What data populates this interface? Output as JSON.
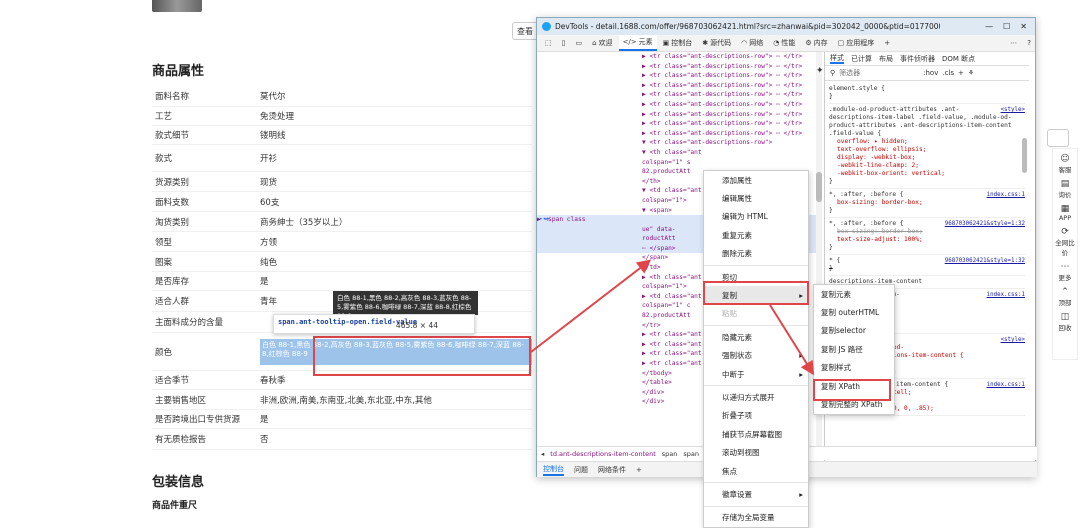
{
  "page": {
    "view_btn": "查看",
    "section_attrs": "商品属性",
    "section_pkg": "包装信息",
    "pkg_sub": "商品件重尺",
    "attrs": [
      {
        "k": "面料名称",
        "v": "莫代尔"
      },
      {
        "k": "工艺",
        "v": "免烫处理"
      },
      {
        "k": "款式细节",
        "v": "镂明线"
      },
      {
        "k": "款式",
        "v": "开衫"
      },
      {
        "k": "货源类别",
        "v": "现货"
      },
      {
        "k": "面料支数",
        "v": "60支"
      },
      {
        "k": "淘货类别",
        "v": "商务绅士（35岁以上）"
      },
      {
        "k": "领型",
        "v": "方领"
      },
      {
        "k": "图案",
        "v": "纯色"
      },
      {
        "k": "是否库存",
        "v": "是"
      },
      {
        "k": "适合人群",
        "v": "青年"
      },
      {
        "k": "主面料成分的含量",
        "v": ""
      },
      {
        "k": "颜色",
        "v": "白色 88-1,黑色 88-2,高灰色 88-3,蓝灰色 88-5,雾紫色 88-6,咖啡绿 88-7,深蓝 88-8,红棕色 88-9"
      },
      {
        "k": "适合季节",
        "v": "春秋季"
      },
      {
        "k": "主要销售地区",
        "v": "非洲,欧洲,南美,东南亚,北美,东北亚,中东,其他"
      },
      {
        "k": "是否跨境出口专供货源",
        "v": "是"
      },
      {
        "k": "有无质检报告",
        "v": "否"
      }
    ],
    "tooltip_text": "白色 88-1,黑色 88-2,高灰色 88-3,蓝灰色 88-5,雾紫色 88-6,咖啡绿 88-7,深蓝 88-8,红棕色 88-9",
    "hint_selector": "span.ant-tooltip-open.field-value",
    "hint_dims": "465.8 × 44"
  },
  "rightbar": [
    "客服",
    "询价",
    "APP",
    "全网比价",
    "更多",
    "顶部",
    "回收"
  ],
  "devtools": {
    "title": "DevTools - detail.1688.com/offer/968703062421.html?src=zhanwai&pid=302042_0000&ptid=01770000000798a6c...",
    "tabs": [
      "欢迎",
      "元素",
      "控制台",
      "源代码",
      "网络",
      "性能",
      "内存",
      "应用程序"
    ],
    "styles_tabs": [
      "样式",
      "已计算",
      "布局",
      "事件侦听器",
      "DOM 断点"
    ],
    "filter_placeholder": "筛选器",
    "filter_hov": ":hov",
    "filter_cls": ".cls",
    "breadcrumb": [
      "td.ant-descriptions-item-content",
      "span",
      "span"
    ],
    "bottom_tabs": [
      "控制台",
      "问题",
      "网络条件"
    ]
  },
  "dom_lines": [
    "▶ <tr class=\"ant-descriptions-row\"> ⋯ </tr>",
    "▶ <tr class=\"ant-descriptions-row\"> ⋯ </tr>",
    "▶ <tr class=\"ant-descriptions-row\"> ⋯ </tr>",
    "▶ <tr class=\"ant-descriptions-row\"> ⋯ </tr>",
    "▶ <tr class=\"ant-descriptions-row\"> ⋯ </tr>",
    "▶ <tr class=\"ant-descriptions-row\"> ⋯ </tr>",
    "▶ <tr class=\"ant-descriptions-row\"> ⋯ </tr>",
    "▶ <tr class=\"ant-descriptions-row\"> ⋯ </tr>",
    "▶ <tr class=\"ant-descriptions-row\"> ⋯ </tr>",
    "▼ <tr class=\"ant-descriptions-row\">",
    "  ▼ <th class=\"ant",
    "      colspan=\"1\" s",
    "      82.productAtt",
    "    </th>",
    "  ▼ <td class=\"ant",
    "      colspan=\"1\">",
    "    ▼ <span>",
    "      ▶ <span class",
    "          ue\" data-",
    "          roductAtt",
    "          ⋯ </span>",
    "      </span>",
    "    </td>",
    "  ▶ <th class=\"ant",
    "      colspan=\"1\">",
    "  ▶ <td class=\"ant",
    "      colspan=\"1\" c",
    "      82.productAtt",
    "  </tr>",
    "▶ <tr class=\"ant-",
    "▶ <tr class=\"ant-",
    "▶ <tr class=\"ant-",
    "▶ <tr class=\"ant-",
    "  </tbody>",
    "  </table>",
    "</div>",
    "</div>"
  ],
  "styles_rules": [
    {
      "sel": "element.style {",
      "props": [
        "}"
      ],
      "src": ""
    },
    {
      "sel": ".module-od-product-attributes .ant-descriptions-item-label .field-value, .module-od-product-attributes .ant-descriptions-item-content .field-value {",
      "props": [
        "overflow: ▸ hidden;",
        "text-overflow: ellipsis;",
        "display: -webkit-box;",
        "-webkit-line-clamp: 2;",
        "-webkit-box-orient: vertical;",
        "}"
      ],
      "src": "<style>"
    },
    {
      "sel": "*, :after, :before {",
      "props": [
        "box-sizing: border-box;",
        "}"
      ],
      "src": "index.css:1"
    },
    {
      "sel": "*, :after, :before {",
      "props": [
        "box-sizing: border-box;",
        "text-size-adjust: 100%;",
        "}"
      ],
      "src": "968703062421&style=1:32"
    },
    {
      "sel": "* {",
      "props": [
        "}"
      ],
      "src": "968703062421&style=1:32"
    },
    {
      "sel": "descriptions-item-content",
      "props": [],
      "src": ""
    },
    {
      "sel": "-descriptions-item-",
      "props": [
        "moma .ant-",
        "-label {",
        "erit;",
        "it;"
      ],
      "src": "index.css:1"
    },
    {
      "sel": "ttributes .ant-",
      "props": [
        "label, .module-od-",
        "s .ant-descriptions-item-content {",
        "important;",
        "od-size-small));"
      ],
      "src": "<style>"
    },
    {
      "sel": ".ant-descriptions-item-content {",
      "props": [
        "display: table-cell;",
        "flex: ▸ 1;",
        "color: rgba(0, 0, 0, .85);"
      ],
      "src": "index.css:1"
    }
  ],
  "menu1": [
    "添加属性",
    "编辑属性",
    "编辑为 HTML",
    "重复元素",
    "删除元素",
    "剪切",
    "复制",
    "粘贴",
    "隐藏元素",
    "强制状态",
    "中断于",
    "以递归方式展开",
    "折叠子项",
    "捕获节点屏幕截图",
    "滚动到视图",
    "焦点",
    "徽章设置",
    "存储为全局变量"
  ],
  "menu2": [
    "复制元素",
    "复制 outerHTML",
    "复制selector",
    "复制 JS 路径",
    "复制样式",
    "复制 XPath",
    "复制完整的 XPath"
  ]
}
